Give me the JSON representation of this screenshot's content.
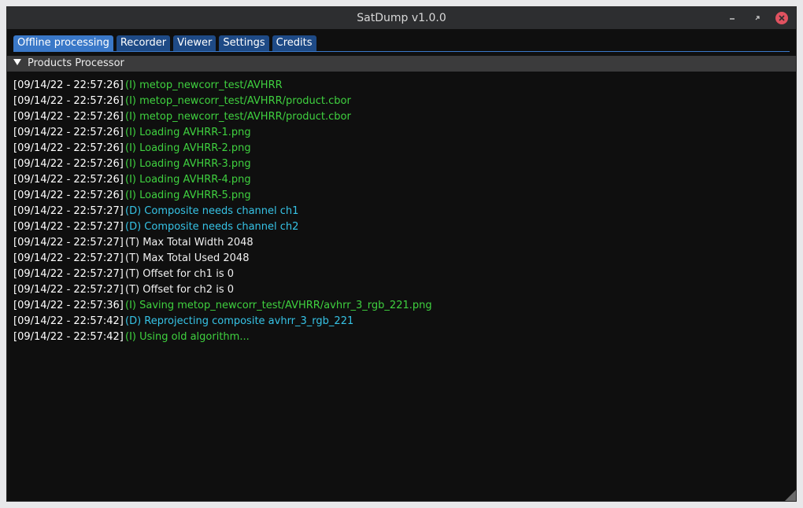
{
  "window": {
    "title": "SatDump v1.0.0",
    "controls": {
      "minimize_icon": "minimize-icon",
      "restore_icon": "restore-icon",
      "close_icon": "close-icon"
    }
  },
  "tabs": [
    {
      "label": "Offline processing",
      "active": true
    },
    {
      "label": "Recorder",
      "active": false
    },
    {
      "label": "Viewer",
      "active": false
    },
    {
      "label": "Settings",
      "active": false
    },
    {
      "label": "Credits",
      "active": false
    }
  ],
  "section": {
    "title": "Products Processor",
    "expanded": true
  },
  "colors": {
    "info": "#3fd13f",
    "debug": "#36c3e6",
    "trace": "#f0f0f0",
    "tab_active": "#3a78c8",
    "tab": "#1e4a86"
  },
  "log": [
    {
      "ts": "[09/14/22 - 22:57:26]",
      "level": "I",
      "msg": "(I) metop_newcorr_test/AVHRR"
    },
    {
      "ts": "[09/14/22 - 22:57:26]",
      "level": "I",
      "msg": "(I) metop_newcorr_test/AVHRR/product.cbor"
    },
    {
      "ts": "[09/14/22 - 22:57:26]",
      "level": "I",
      "msg": "(I) metop_newcorr_test/AVHRR/product.cbor"
    },
    {
      "ts": "[09/14/22 - 22:57:26]",
      "level": "I",
      "msg": "(I) Loading AVHRR-1.png"
    },
    {
      "ts": "[09/14/22 - 22:57:26]",
      "level": "I",
      "msg": "(I) Loading AVHRR-2.png"
    },
    {
      "ts": "[09/14/22 - 22:57:26]",
      "level": "I",
      "msg": "(I) Loading AVHRR-3.png"
    },
    {
      "ts": "[09/14/22 - 22:57:26]",
      "level": "I",
      "msg": "(I) Loading AVHRR-4.png"
    },
    {
      "ts": "[09/14/22 - 22:57:26]",
      "level": "I",
      "msg": "(I) Loading AVHRR-5.png"
    },
    {
      "ts": "[09/14/22 - 22:57:27]",
      "level": "D",
      "msg": "(D) Composite needs channel ch1"
    },
    {
      "ts": "[09/14/22 - 22:57:27]",
      "level": "D",
      "msg": "(D) Composite needs channel ch2"
    },
    {
      "ts": "[09/14/22 - 22:57:27]",
      "level": "T",
      "msg": "(T) Max Total Width 2048"
    },
    {
      "ts": "[09/14/22 - 22:57:27]",
      "level": "T",
      "msg": "(T) Max Total Used  2048"
    },
    {
      "ts": "[09/14/22 - 22:57:27]",
      "level": "T",
      "msg": "(T) Offset for ch1 is 0"
    },
    {
      "ts": "[09/14/22 - 22:57:27]",
      "level": "T",
      "msg": "(T) Offset for ch2 is 0"
    },
    {
      "ts": "[09/14/22 - 22:57:36]",
      "level": "I",
      "msg": "(I) Saving metop_newcorr_test/AVHRR/avhrr_3_rgb_221.png"
    },
    {
      "ts": "[09/14/22 - 22:57:42]",
      "level": "D",
      "msg": "(D) Reprojecting composite avhrr_3_rgb_221"
    },
    {
      "ts": "[09/14/22 - 22:57:42]",
      "level": "I",
      "msg": "(I) Using old algorithm..."
    }
  ]
}
